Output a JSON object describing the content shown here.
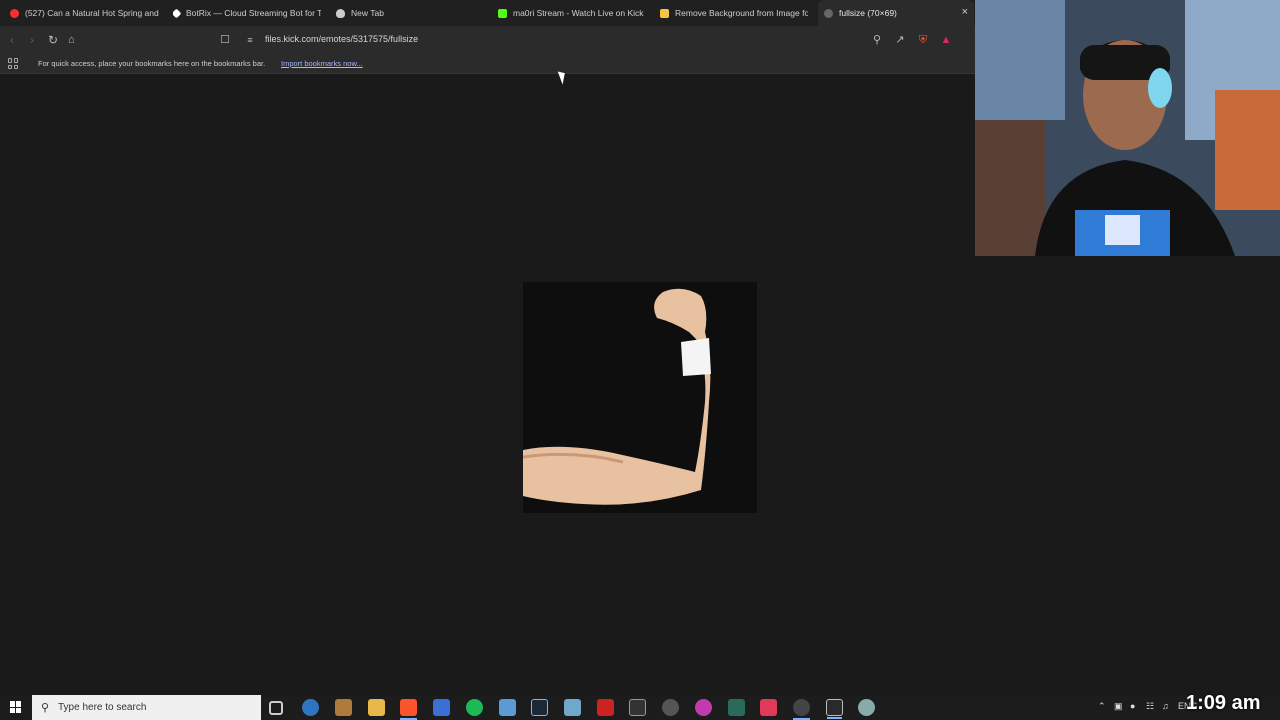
{
  "browser": {
    "tabs": [
      {
        "label": "(527) Can a Natural Hot Spring and ...",
        "color": "#ff2d2d",
        "active": false
      },
      {
        "label": "BotRix — Cloud Streaming Bot for T...",
        "color": "#ffffff",
        "active": false
      },
      {
        "label": "New Tab",
        "color": "#cccccc",
        "active": false
      },
      {
        "label": "ma0ri Stream - Watch Live on Kick",
        "color": "#53fc18",
        "active": false
      },
      {
        "label": "Remove Background from Image for...",
        "color": "#f5c542",
        "active": false
      },
      {
        "label": "fullsize (70×69)",
        "color": "#888888",
        "active": true
      }
    ],
    "tab_close": "×",
    "url": "files.kick.com/emotes/5317575/fullsize",
    "bookmarks_bar": {
      "message": "For quick access, place your bookmarks here on the bookmarks bar.",
      "link": "Import bookmarks now..."
    }
  },
  "taskbar": {
    "search_placeholder": "Type here to search",
    "tray_lang": "ENG",
    "clock": "1:09 am"
  },
  "colors": {
    "accent": "#7ab3ff",
    "kick_green": "#53fc18",
    "brave_orange": "#fb542b"
  }
}
